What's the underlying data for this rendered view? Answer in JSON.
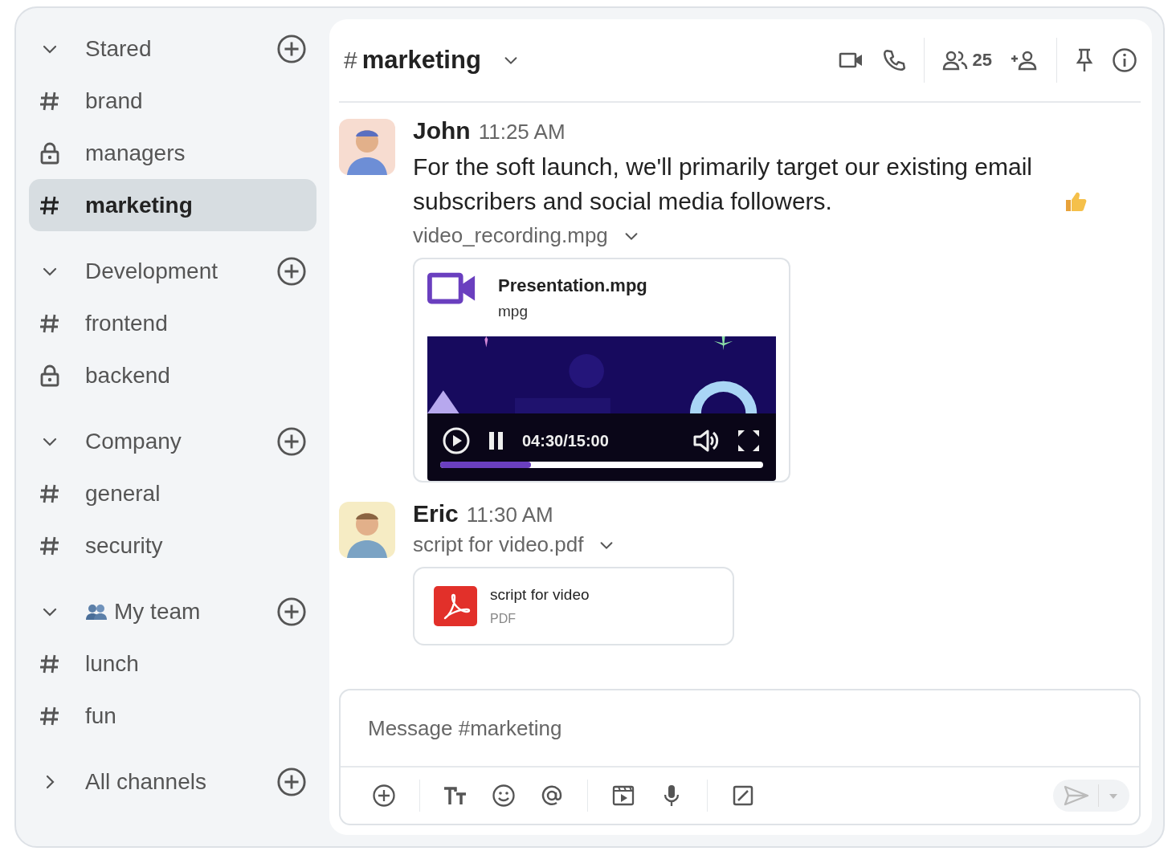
{
  "sidebar": {
    "sections": [
      {
        "title": "Stared",
        "kind": "plain",
        "expanded": true,
        "channels": [
          {
            "name": "brand",
            "kind": "public",
            "selected": false
          },
          {
            "name": "managers",
            "kind": "private",
            "selected": false
          },
          {
            "name": "marketing",
            "kind": "public",
            "selected": true
          }
        ]
      },
      {
        "title": "Development",
        "kind": "plain",
        "expanded": true,
        "channels": [
          {
            "name": "frontend",
            "kind": "public",
            "selected": false
          },
          {
            "name": "backend",
            "kind": "private",
            "selected": false
          }
        ]
      },
      {
        "title": "Company",
        "kind": "plain",
        "expanded": true,
        "channels": [
          {
            "name": "general",
            "kind": "public",
            "selected": false
          },
          {
            "name": "security",
            "kind": "public",
            "selected": false
          }
        ]
      },
      {
        "title": "My team",
        "kind": "team",
        "expanded": true,
        "channels": [
          {
            "name": "lunch",
            "kind": "public",
            "selected": false
          },
          {
            "name": "fun",
            "kind": "public",
            "selected": false
          }
        ]
      },
      {
        "title": "All channels",
        "kind": "plain",
        "expanded": false
      }
    ]
  },
  "header": {
    "prefix": "#",
    "channel": "marketing",
    "member_count": "25"
  },
  "messages": [
    {
      "author": "John",
      "time": "11:25 AM",
      "text": "For the soft launch, we'll primarily target our existing email subscribers and social media followers.",
      "reaction_emoji": true,
      "attachment": {
        "filename": "video_recording.mpg",
        "card": {
          "kind": "video",
          "title": "Presentation.mpg",
          "type": "mpg",
          "time": "04:30/15:00",
          "level": 0.28
        }
      }
    },
    {
      "author": "Eric",
      "time": "11:30 AM",
      "attachment": {
        "filename": "script for video.pdf",
        "card": {
          "kind": "pdf",
          "title": "script for video",
          "type": "PDF"
        }
      }
    }
  ],
  "composer": {
    "placeholder": "Message #marketing"
  }
}
